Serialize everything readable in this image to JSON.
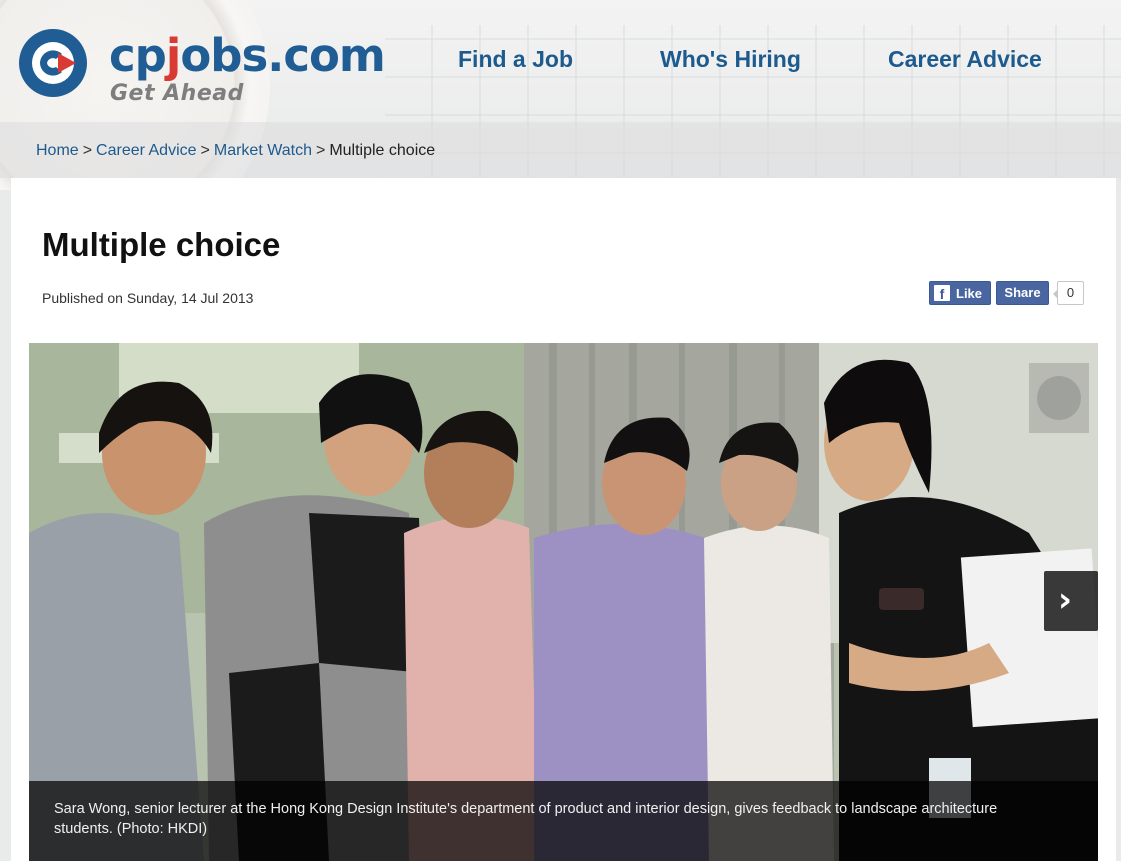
{
  "site": {
    "logo_text_a": "cp",
    "logo_text_j": "j",
    "logo_text_b": "obs.com",
    "tagline": "Get Ahead",
    "brand_blue": "#1f5d94",
    "brand_red": "#d93a34"
  },
  "nav": {
    "items": [
      {
        "label": "Find a Job"
      },
      {
        "label": "Who's Hiring"
      },
      {
        "label": "Career Advice"
      }
    ]
  },
  "breadcrumb": {
    "items": [
      {
        "label": "Home"
      },
      {
        "label": "Career Advice"
      },
      {
        "label": "Market Watch"
      }
    ],
    "separator": ">",
    "current": "Multiple choice"
  },
  "article": {
    "title": "Multiple choice",
    "published": "Published on Sunday, 14 Jul 2013",
    "social": {
      "like_label": "Like",
      "share_label": "Share",
      "share_count": "0",
      "fb_icon": "facebook-icon"
    },
    "photo": {
      "caption": "Sara Wong, senior lecturer at the Hong Kong Design Institute's department of product and interior design, gives feedback to landscape architecture students. (Photo: HKDI)",
      "next_icon": "chevron-right-icon",
      "next_glyph": "›"
    }
  }
}
